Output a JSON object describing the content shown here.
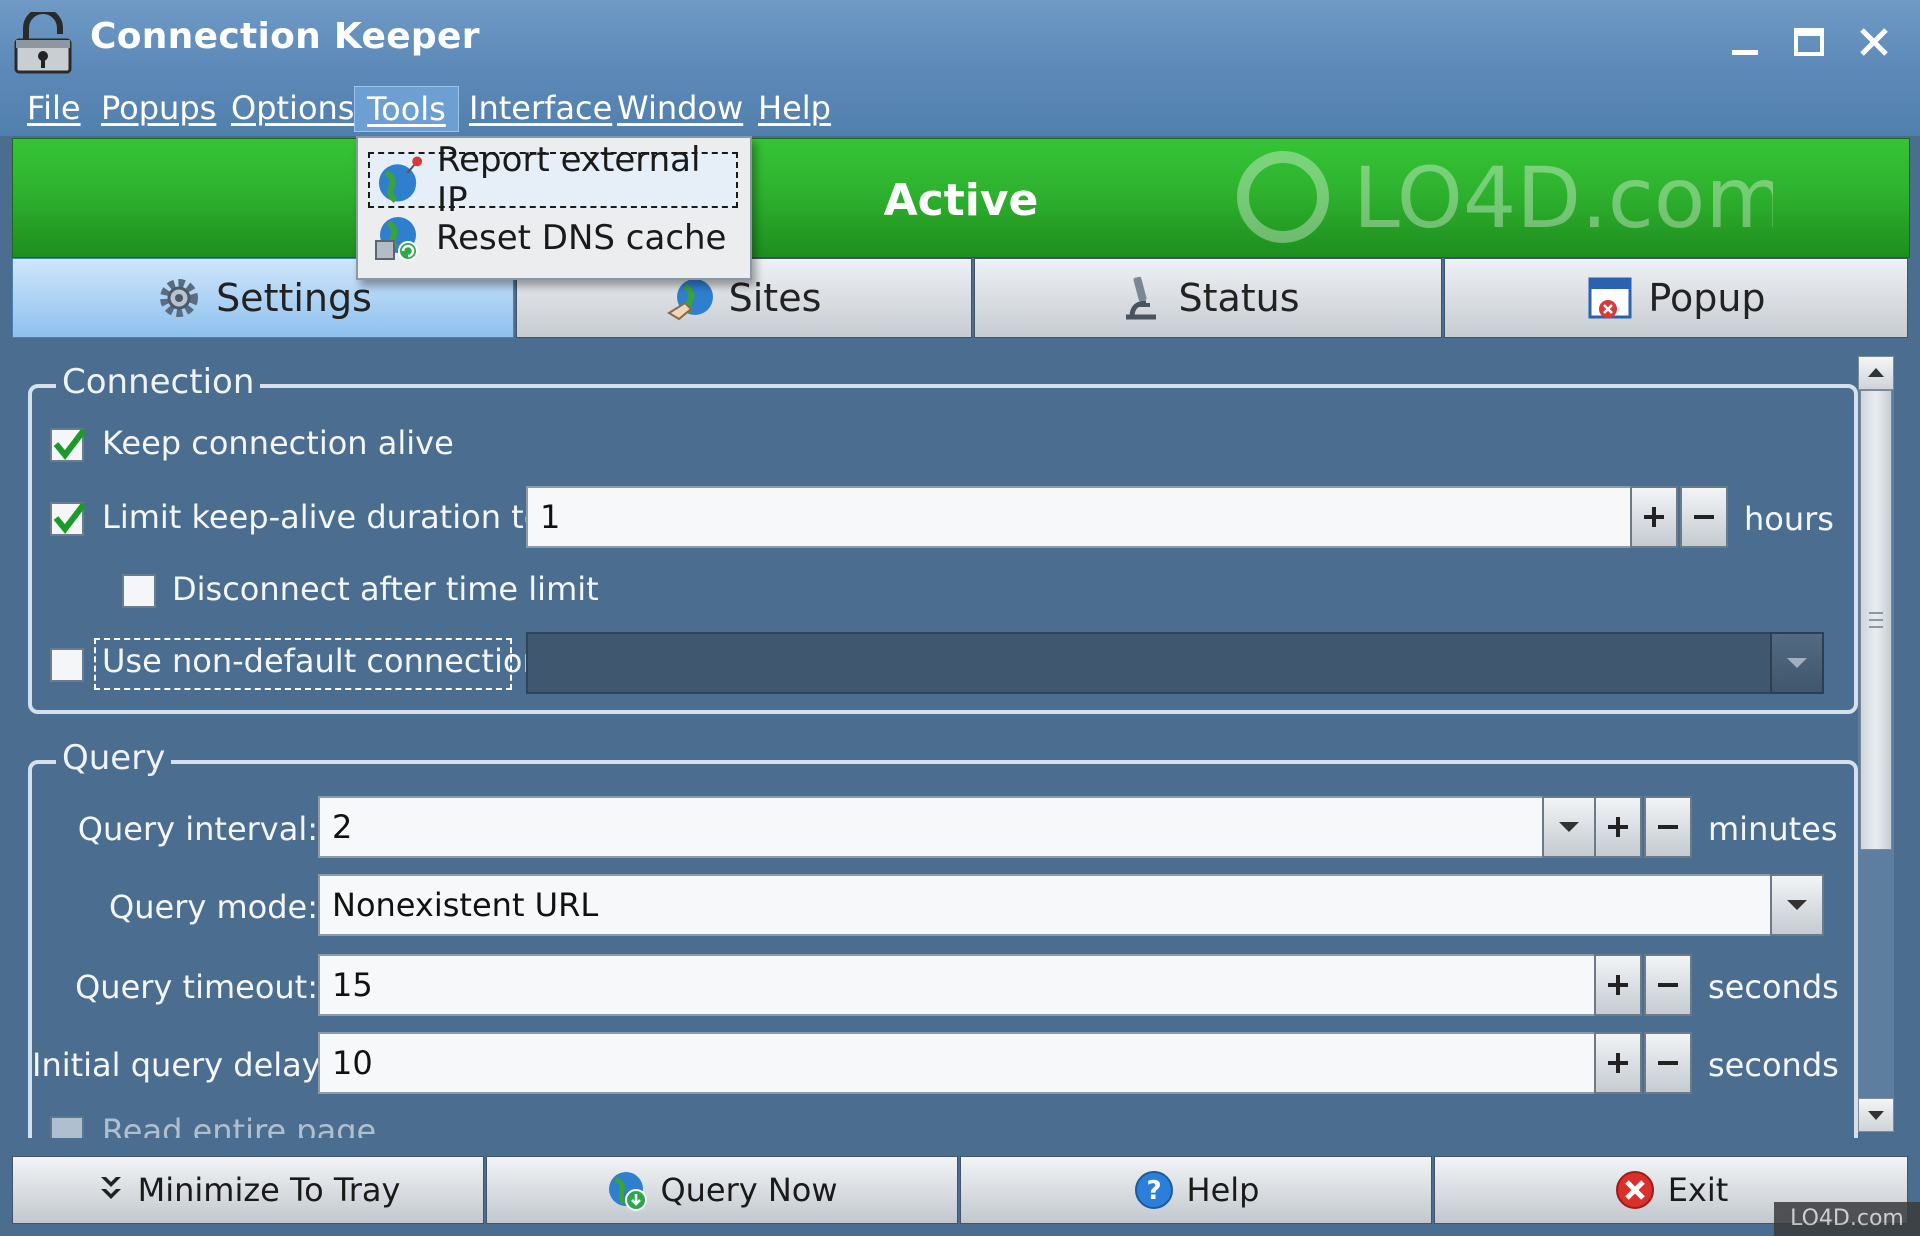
{
  "window": {
    "title": "Connection Keeper"
  },
  "menu": [
    "File",
    "Popups",
    "Options",
    "Tools",
    "Interface",
    "Window",
    "Help"
  ],
  "tools_menu": {
    "items": [
      "Report external IP",
      "Reset DNS cache"
    ]
  },
  "banner": {
    "status": "Active",
    "color": "#2eb22e"
  },
  "watermark": {
    "text": "LO4D.com"
  },
  "tabs": [
    "Settings",
    "Sites",
    "Status",
    "Popup"
  ],
  "connection": {
    "legend": "Connection",
    "keep_alive": {
      "label": "Keep connection alive",
      "checked": true
    },
    "limit_duration": {
      "label": "Limit keep-alive duration to:",
      "checked": true,
      "value": "1",
      "unit": "hours"
    },
    "disconnect_after": {
      "label": "Disconnect after time limit",
      "checked": false
    },
    "non_default": {
      "label": "Use non-default connection:",
      "checked": false,
      "value": ""
    }
  },
  "query": {
    "legend": "Query",
    "interval": {
      "label": "Query interval:",
      "value": "2",
      "unit": "minutes"
    },
    "mode": {
      "label": "Query mode:",
      "value": "Nonexistent URL"
    },
    "timeout": {
      "label": "Query timeout:",
      "value": "15",
      "unit": "seconds"
    },
    "initial_delay": {
      "label": "Initial query delay:",
      "value": "10",
      "unit": "seconds"
    },
    "read_entire_page": {
      "label": "Read entire page",
      "checked": false
    }
  },
  "buttons": [
    "Minimize To Tray",
    "Query Now",
    "Help",
    "Exit"
  ],
  "corner_watermark": "LO4D.com"
}
